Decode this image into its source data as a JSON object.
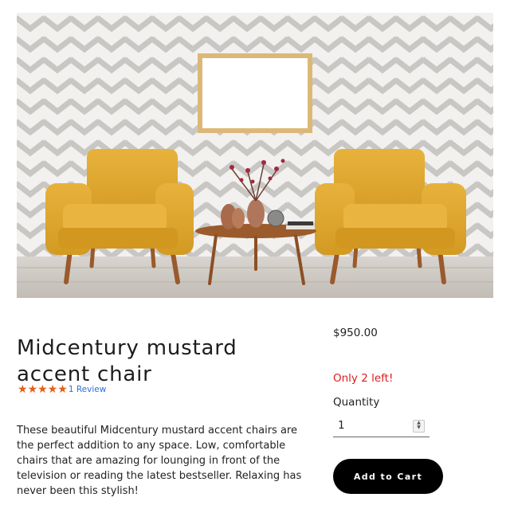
{
  "product": {
    "image_alt": "Midcentury mustard accent chair",
    "title": "Midcentury mustard accent chair",
    "rating": 5,
    "review_link": "1 Review",
    "description": "These beautiful Midcentury mustard accent chairs are the perfect addition to any space. Low, comfortable chairs that are amazing for lounging in front of the television or reading the latest bestseller. Relaxing has never been this stylish!",
    "price": "$950.00",
    "stock_notice": "Only 2 left!",
    "quantity_label": "Quantity",
    "quantity_value": "1",
    "add_to_cart_label": "Add to Cart"
  },
  "colors": {
    "accent_star": "#e1601b",
    "stock_warning": "#d91e1e",
    "button_bg": "#000000",
    "link": "#2a6fd6"
  },
  "icons": [
    "star-icon",
    "stepper-up-icon",
    "stepper-down-icon"
  ]
}
